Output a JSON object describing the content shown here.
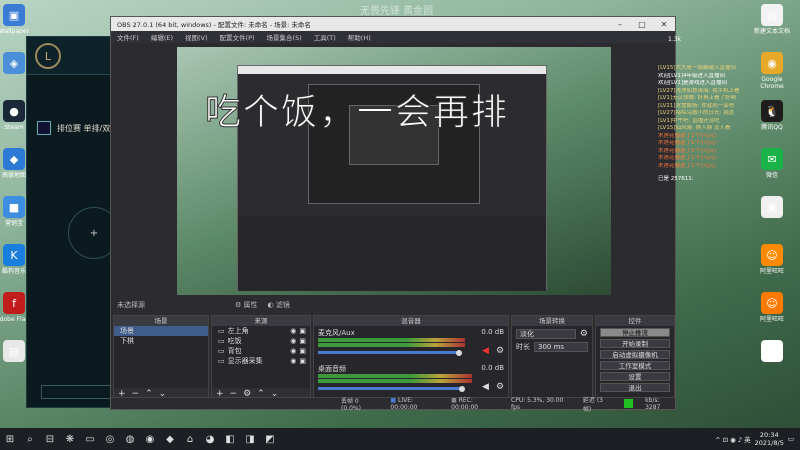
{
  "desktop": {
    "top_text": "无畏先锋  黄金圆",
    "icons_left": [
      {
        "label": "Wallpaper",
        "color": "#3a7bd5",
        "glyph": "▣"
      },
      {
        "label": "",
        "color": "#4a8fd8",
        "glyph": "◈"
      },
      {
        "label": "Steam",
        "color": "#1b2838",
        "glyph": "●"
      },
      {
        "label": "高德地图",
        "color": "#2d7ad6",
        "glyph": "◆"
      },
      {
        "label": "营销宝",
        "color": "#3d8de0",
        "glyph": "■"
      },
      {
        "label": "酷狗音乐",
        "color": "#1a7fdc",
        "glyph": "K"
      },
      {
        "label": "Adobe Flash",
        "color": "#c21d1d",
        "glyph": "f"
      },
      {
        "label": "",
        "color": "#e8e8e8",
        "glyph": "▤"
      }
    ],
    "icons_right": [
      {
        "label": "新建文本文档",
        "color": "#f2f2f2",
        "glyph": "▤"
      },
      {
        "label": "Google Chrome",
        "color": "#e8a82a",
        "glyph": "◉"
      },
      {
        "label": "腾讯QQ",
        "color": "#1d1d1d",
        "glyph": "🐧"
      },
      {
        "label": "微信",
        "color": "#19b34a",
        "glyph": "✉"
      },
      {
        "label": "",
        "color": "#f0f0f0",
        "glyph": "▣"
      },
      {
        "label": "阿里旺旺",
        "color": "#ff8a00",
        "glyph": "☺"
      },
      {
        "label": "阿里旺旺",
        "color": "#ff7a00",
        "glyph": "☺"
      },
      {
        "label": "",
        "color": "#ffffff",
        "glyph": "▤"
      }
    ]
  },
  "game": {
    "mode_label": "排位赛 单排/双",
    "logo": "L"
  },
  "obs": {
    "title": "OBS 27.0.1 (64 bit, windows) - 配置文件: 未命名 - 场景: 未命名",
    "menu": [
      "文件(F)",
      "编辑(E)",
      "视图(V)",
      "配置文件(P)",
      "场景集合(S)",
      "工具(T)",
      "帮助(H)"
    ],
    "overlay_text": "吃个饭，一会再排",
    "status_row": {
      "scene_state": "未选择源",
      "props": "属性",
      "filters": "滤镜"
    },
    "scenes": {
      "header": "场景",
      "items": [
        "场景",
        "下棋"
      ],
      "selected": 0
    },
    "sources": {
      "header": "来源",
      "items": [
        "左上角",
        "吃饭",
        "背包",
        "显示器采集"
      ]
    },
    "mixer": {
      "header": "混音器",
      "channels": [
        {
          "name": "麦克风/Aux",
          "db": "0.0 dB",
          "level": 0.92,
          "volume": 0.88
        },
        {
          "name": "桌面音频",
          "db": "0.0 dB",
          "level": 0.96,
          "volume": 0.9
        }
      ]
    },
    "transitions": {
      "header": "场景转换",
      "type": "淡化",
      "duration_label": "时长",
      "duration": "300 ms"
    },
    "controls": {
      "header": "控件",
      "buttons": [
        "停止推流",
        "开始录制",
        "启动虚拟摄像机",
        "工作室模式",
        "设置",
        "退出"
      ],
      "selected": 0
    },
    "statusbar": {
      "dropped": "丢帧 0 (0.0%)",
      "live": "LIVE: 00:00:00",
      "rec": "REC: 00:00:00",
      "cpu": "CPU: 5.3%, 30.00 fps",
      "lag": "延迟 (3 帧)",
      "kbps": "kb/s: 3287"
    }
  },
  "chat": {
    "top": "1.3k",
    "lines": [
      {
        "text": "[LV15]大大哥一路翻越入直播间",
        "color": "#e8d27a"
      },
      {
        "text": "欢迎[LV1]4年级进入直播间",
        "color": "#ffffff"
      },
      {
        "text": "欢迎[LV1]是游戏进入直播间",
        "color": "#ffffff"
      },
      {
        "text": "[LV27]洗净如意涛海:  我手机上看",
        "color": "#e8d27a"
      },
      {
        "text": "[LV1]无认领微: 好再上看了好啊",
        "color": "#e8d27a"
      },
      {
        "text": "[LV21]冰雪飘扬: 你就到一会吧",
        "color": "#e8d27a"
      },
      {
        "text": "[LV27]咕咕鸟微小的日光: 我这",
        "color": "#e8d27a"
      },
      {
        "text": "[LV1]中午吧: 直播还没吃",
        "color": "#e8d27a"
      },
      {
        "text": "[LV15]仙风晓: 换人换 没人看",
        "color": "#e8d27a"
      },
      {
        "text": "木莲花赠送了1个小心心",
        "color": "#ff7a3a"
      },
      {
        "text": "木莲花赠送了1个小心心",
        "color": "#ff7a3a"
      },
      {
        "text": "木莲花赠送了1个小心心",
        "color": "#ff7a3a"
      },
      {
        "text": "木莲花赠送了1个小心心",
        "color": "#ff7a3a"
      },
      {
        "text": "木莲花赠送了1个小心心",
        "color": "#ff7a3a"
      }
    ],
    "footer": "已是 257611:"
  },
  "taskbar": {
    "icons": [
      "⊞",
      "⌕",
      "⊟",
      "❋",
      "▭",
      "◎",
      "◍",
      "◉",
      "◆",
      "⌂",
      "◕",
      "◧",
      "◨",
      "◩"
    ],
    "tray": "^ ⊡ ◉ ♪ 英",
    "time": "20:34",
    "date": "2021/8/5",
    "notif": "▭"
  }
}
